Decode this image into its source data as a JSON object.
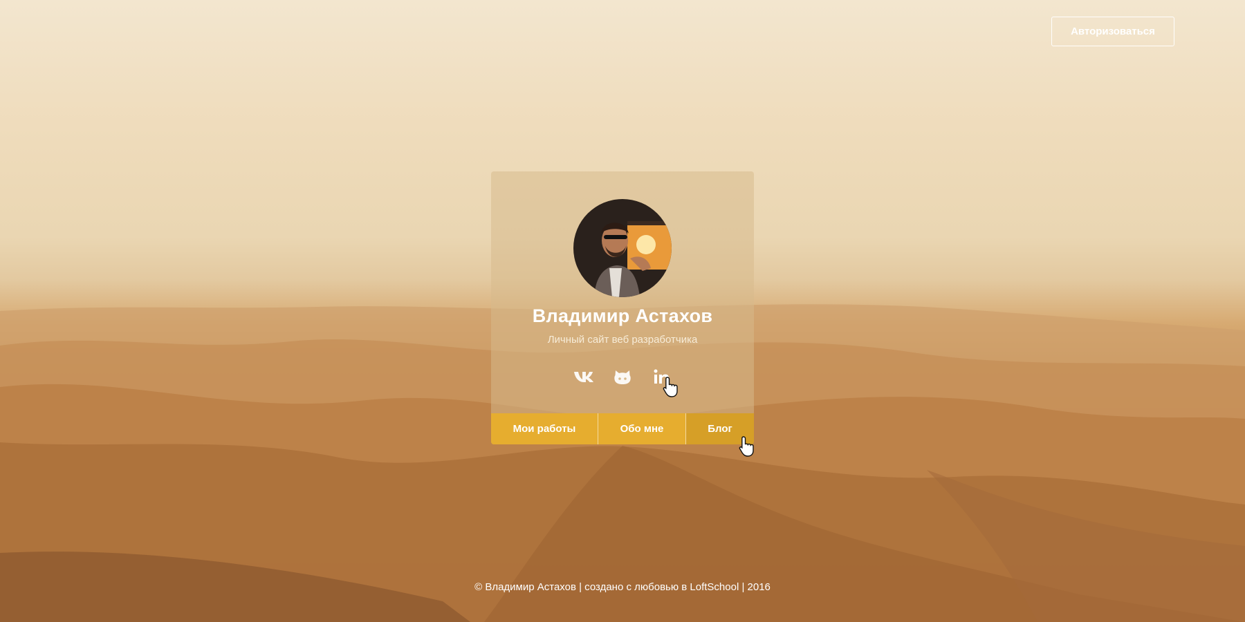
{
  "header": {
    "auth_button_label": "Авторизоваться"
  },
  "card": {
    "name": "Владимир Астахов",
    "subtitle": "Личный сайт веб разработчика",
    "socials": [
      {
        "icon": "vk-icon"
      },
      {
        "icon": "github-icon"
      },
      {
        "icon": "linkedin-icon"
      }
    ]
  },
  "nav": {
    "items": [
      {
        "label": "Мои работы"
      },
      {
        "label": "Обо мне"
      },
      {
        "label": "Блог"
      }
    ]
  },
  "footer": {
    "text": "© Владимир Астахов | создано с любовью в LoftSchool | 2016"
  },
  "colors": {
    "accent": "#e6ad2f",
    "accent_active": "#d69f27"
  }
}
